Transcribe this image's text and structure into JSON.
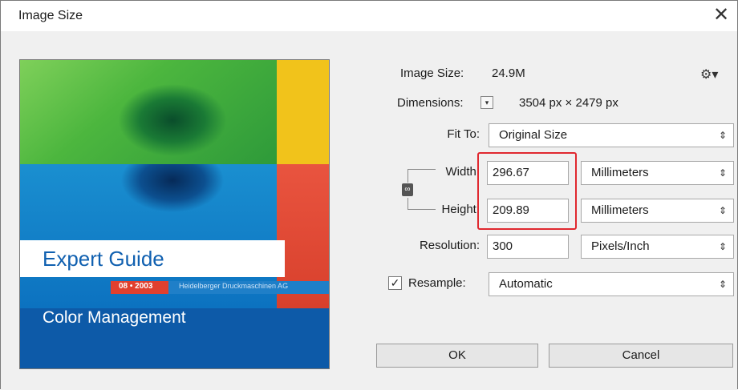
{
  "window": {
    "title": "Image Size",
    "close_glyph": "✕"
  },
  "preview": {
    "cover_title": "Expert Guide",
    "cover_date": "08 • 2003",
    "cover_publisher": "Heidelberger Druckmaschinen AG",
    "cover_subtitle": "Color Management"
  },
  "info": {
    "image_size_label": "Image Size:",
    "image_size_value": "24.9M",
    "dimensions_label": "Dimensions:",
    "dimensions_value": "3504 px  ×  2479 px",
    "gear_icon": "gear-icon"
  },
  "fields": {
    "fit_to_label": "Fit To:",
    "fit_to_value": "Original Size",
    "width_label": "Width:",
    "width_value": "296.67",
    "width_unit": "Millimeters",
    "height_label": "Height:",
    "height_value": "209.89",
    "height_unit": "Millimeters",
    "resolution_label": "Resolution:",
    "resolution_value": "300",
    "resolution_unit": "Pixels/Inch",
    "resample_label": "Resample:",
    "resample_checked": true,
    "resample_value": "Automatic"
  },
  "buttons": {
    "ok": "OK",
    "cancel": "Cancel"
  },
  "colors": {
    "highlight": "#e0282f"
  }
}
